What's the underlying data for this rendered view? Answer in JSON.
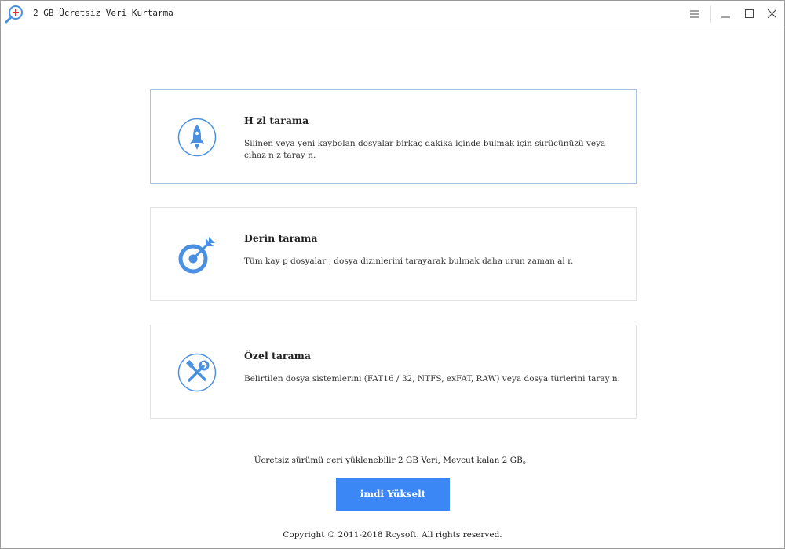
{
  "window": {
    "title": "2 GB Ücretsiz Veri Kurtarma",
    "controls": {
      "menu": "☰",
      "minimize": "—",
      "maximize": "☐",
      "close": "✕"
    }
  },
  "scan_options": [
    {
      "title": "H zl  tarama",
      "description": "Silinen veya yeni kaybolan dosyalar  birkaç dakika içinde bulmak için sürücünüzü veya cihaz n z  taray n.",
      "icon": "rocket-icon"
    },
    {
      "title": "Derin tarama",
      "description": "Tüm kay p dosyalar , dosya dizinlerini tarayarak bulmak daha urun zaman al r.",
      "icon": "target-arrow-icon"
    },
    {
      "title": "Özel tarama",
      "description": "Belirtilen dosya sistemlerini (FAT16 / 32, NTFS, exFAT, RAW) veya dosya türlerini taray n.",
      "icon": "tools-icon"
    }
  ],
  "footer": {
    "quota_text": "Ücretsiz sürümü geri yüklenebilir 2 GB Veri, Mevcut kalan 2 GB。",
    "upgrade_label": " imdi Yükselt",
    "copyright": "Copyright © 2011-2018 Rcysoft. All rights reserved."
  },
  "colors": {
    "accent": "#3b87f5",
    "icon_blue": "#4a90e2",
    "selected_border": "#a9c4e2",
    "card_border": "#e2e2e2"
  }
}
